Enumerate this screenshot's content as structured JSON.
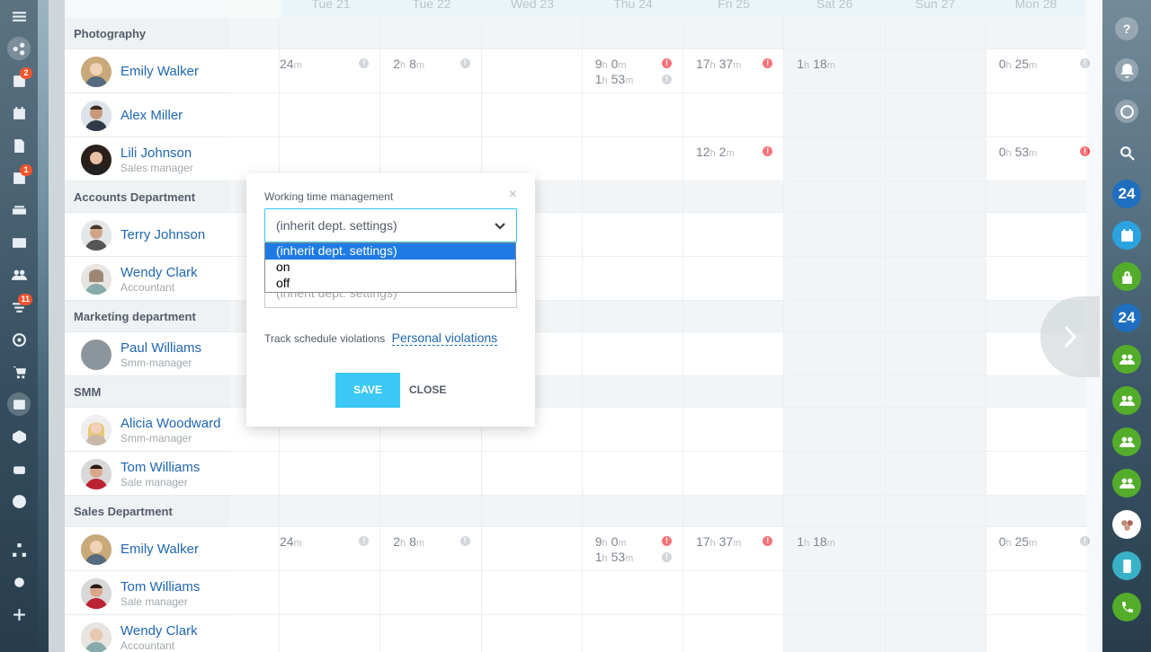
{
  "days": [
    "Tue 21",
    "Tue 22",
    "Wed 23",
    "Thu 24",
    "Fri 25",
    "Sat 26",
    "Sun 27",
    "Mon 28"
  ],
  "left_sidebar": {
    "items": [
      {
        "icon": "menu-icon"
      },
      {
        "icon": "activity-stream-icon"
      },
      {
        "icon": "feed-icon",
        "badge": "2"
      },
      {
        "icon": "calendar-icon"
      },
      {
        "icon": "documents-icon"
      },
      {
        "icon": "tasks-icon",
        "badge": "1"
      },
      {
        "icon": "drive-icon"
      },
      {
        "icon": "mail-icon"
      },
      {
        "icon": "employees-icon"
      },
      {
        "icon": "crm-filter-icon",
        "badge": "11"
      },
      {
        "icon": "target-icon"
      },
      {
        "icon": "cart-icon"
      },
      {
        "icon": "contact-card-icon"
      },
      {
        "icon": "box-icon"
      },
      {
        "icon": "robot-icon"
      },
      {
        "icon": "more-icon"
      },
      {
        "icon": "sitemap-icon"
      },
      {
        "icon": "settings-icon"
      },
      {
        "icon": "add-icon"
      }
    ]
  },
  "right_sidebar": [
    {
      "icon": "help-icon",
      "label": "?"
    },
    {
      "icon": "notifications-icon"
    },
    {
      "icon": "chat-icon"
    },
    {
      "icon": "search-icon"
    },
    {
      "icon": "bitrix24-icon",
      "label": "24"
    },
    {
      "icon": "calendar-app-icon"
    },
    {
      "icon": "lock-icon"
    },
    {
      "icon": "bitrix24-icon",
      "label": "24"
    },
    {
      "icon": "group-chat-icon"
    },
    {
      "icon": "group-chat-icon"
    },
    {
      "icon": "group-chat-icon"
    },
    {
      "icon": "group-chat-icon"
    },
    {
      "icon": "user-group-avatar-icon"
    },
    {
      "icon": "phone-transfer-icon"
    },
    {
      "icon": "phone-call-icon"
    }
  ],
  "rows": [
    {
      "type": "dept",
      "label": "Photography"
    },
    {
      "type": "user",
      "name": "Emily Walker",
      "position": "",
      "cells": [
        [
          "24",
          "m",
          "",
          "grey"
        ],
        [
          "2",
          "h",
          "8",
          "m",
          "grey"
        ],
        null,
        [
          "9",
          "h",
          "0",
          "m",
          "red",
          "1",
          "h",
          "53",
          "m",
          "grey"
        ],
        [
          "17",
          "h",
          "37",
          "m",
          "red"
        ],
        [
          "1",
          "h",
          "18",
          "m"
        ],
        null,
        [
          "0",
          "h",
          "25",
          "m",
          "grey"
        ]
      ]
    },
    {
      "type": "user",
      "name": "Alex Miller",
      "position": ""
    },
    {
      "type": "user",
      "name": "Lili Johnson",
      "position": "Sales manager"
    },
    {
      "type": "dept",
      "label": "Accounts Department"
    },
    {
      "type": "user",
      "name": "Terry Johnson",
      "position": ""
    },
    {
      "type": "user",
      "name": "Wendy Clark",
      "position": "Accountant"
    },
    {
      "type": "dept",
      "label": "Marketing department"
    },
    {
      "type": "user",
      "name": "Paul Williams",
      "position": "Smm-manager"
    },
    {
      "type": "dept",
      "label": "SMM"
    },
    {
      "type": "user",
      "name": "Alicia Woodward",
      "position": "Smm-manager"
    },
    {
      "type": "user",
      "name": "Tom Williams",
      "position": "Sale manager"
    },
    {
      "type": "dept",
      "label": "Sales Department"
    },
    {
      "type": "user",
      "name": "Emily Walker",
      "position": ""
    },
    {
      "type": "user",
      "name": "Tom Williams",
      "position": "Sale manager"
    },
    {
      "type": "user",
      "name": "Wendy Clark",
      "position": "Accountant"
    }
  ],
  "times": {
    "tue21": {
      "h": "24",
      "unit": "m"
    },
    "tue22": {
      "h": "2",
      "hu": "h",
      "m": "8",
      "mu": "m"
    },
    "thu24a": {
      "h": "9",
      "hu": "h",
      "m": "0",
      "mu": "m"
    },
    "thu24b": {
      "h": "1",
      "hu": "h",
      "m": "53",
      "mu": "m"
    },
    "fri25": {
      "h": "17",
      "hu": "h",
      "m": "37",
      "mu": "m"
    },
    "sat26": {
      "h": "1",
      "hu": "h",
      "m": "18",
      "mu": "m"
    },
    "mon28": {
      "h": "0",
      "hu": "h",
      "m": "25",
      "mu": "m"
    },
    "lili_fri25": {
      "h": "12",
      "hu": "h",
      "m": "2",
      "mu": "m"
    },
    "lili_mon28": {
      "h": "0",
      "hu": "h",
      "m": "53",
      "mu": "m"
    },
    "alert": "!"
  },
  "popup": {
    "title": "Working time management",
    "close_x": "×",
    "select_value": "(inherit dept. settings)",
    "options": [
      "(inherit dept. settings)",
      "on",
      "off"
    ],
    "second_select_value": "(inherit dept. settings)",
    "track_label": "Track schedule violations",
    "track_link": "Personal violations",
    "save": "SAVE",
    "close": "CLOSE"
  },
  "colors": {
    "accent": "#3bc8f5",
    "link": "#2067b0",
    "alert": "#f2454b"
  }
}
